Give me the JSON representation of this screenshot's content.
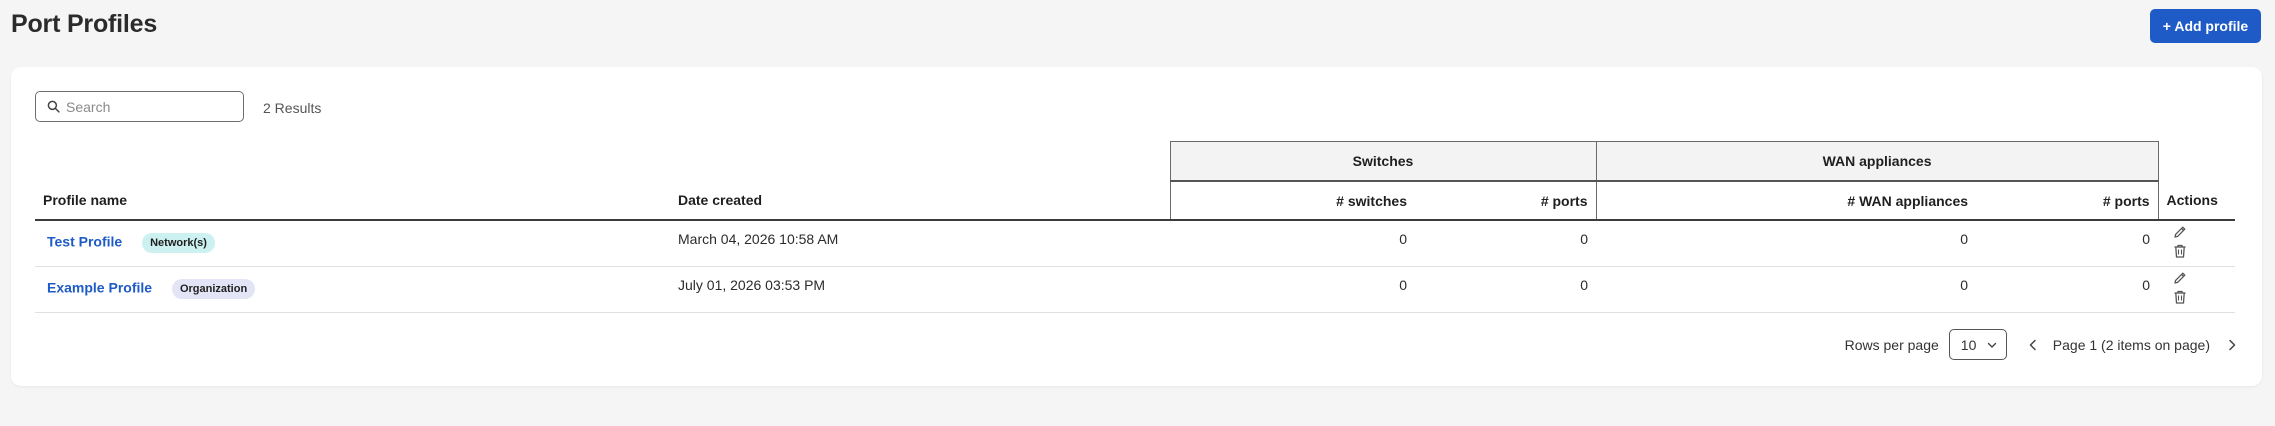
{
  "header": {
    "title": "Port Profiles",
    "add_button": "+ Add profile"
  },
  "toolbar": {
    "search_placeholder": "Search",
    "search_value": "",
    "results": "2 Results"
  },
  "table": {
    "groups": {
      "switches": "Switches",
      "wan": "WAN appliances"
    },
    "columns": {
      "profile_name": "Profile name",
      "date_created": "Date created",
      "switches": "# switches",
      "switch_ports": "# ports",
      "wan_appliances": "# WAN appliances",
      "wan_ports": "# ports",
      "actions": "Actions"
    },
    "rows": [
      {
        "name": "Test Profile",
        "badge": "Network(s)",
        "date": "March 04, 2026 10:58 AM",
        "switches": "0",
        "switch_ports": "0",
        "wan_appliances": "0",
        "wan_ports": "0"
      },
      {
        "name": "Example Profile",
        "badge": "Organization",
        "date": "July 01, 2026 03:53 PM",
        "switches": "0",
        "switch_ports": "0",
        "wan_appliances": "0",
        "wan_ports": "0"
      }
    ]
  },
  "pagination": {
    "rows_per_page_label": "Rows per page",
    "rows_per_page_value": "10",
    "page_info": "Page 1 (2 items on page)"
  },
  "colors": {
    "accent": "#1f5bc6",
    "badge_network": "#cdf0f0",
    "badge_organization": "#e4e4f7"
  },
  "icons": [
    "search-icon",
    "edit-icon",
    "delete-icon",
    "chevron-down-icon",
    "chevron-left-icon",
    "chevron-right-icon"
  ]
}
